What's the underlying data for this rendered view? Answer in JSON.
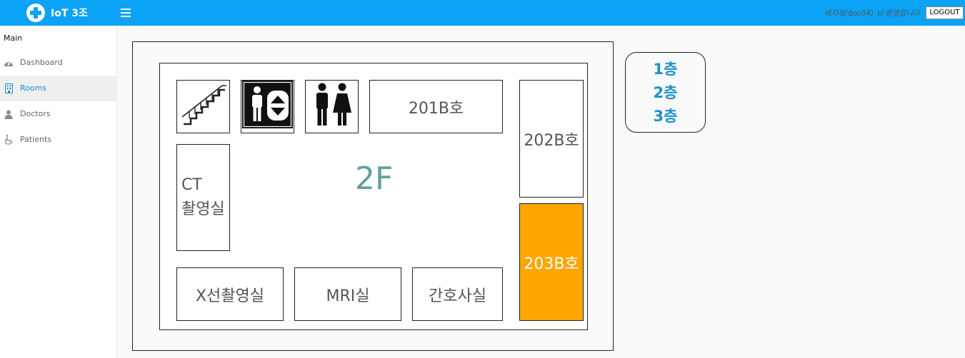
{
  "header": {
    "brand": "IoT 3조",
    "welcome": "배지희(doc04) 님 환영합니다.",
    "logout_label": "LOGOUT",
    "background_color": "#0aa3f5"
  },
  "sidebar": {
    "section": "Main",
    "items": [
      {
        "label": "Dashboard",
        "icon": "dashboard-icon",
        "active": false
      },
      {
        "label": "Rooms",
        "icon": "building-icon",
        "active": true
      },
      {
        "label": "Doctors",
        "icon": "doctor-icon",
        "active": false
      },
      {
        "label": "Patients",
        "icon": "wheelchair-icon",
        "active": false
      }
    ]
  },
  "floorplan": {
    "floor": "2F",
    "rooms": {
      "r201": "201B호",
      "r202": "202B호",
      "r203": "203B호",
      "ct_line1": "CT",
      "ct_line2": "촬영실",
      "xray": "X선촬영실",
      "mri": "MRI실",
      "nurse": "간호사실"
    },
    "facilities": [
      "stairs-icon",
      "elevator-icon",
      "restroom-icon"
    ],
    "highlight_color": "#ffa500"
  },
  "floor_menu": {
    "items": [
      "1층",
      "2층",
      "3층"
    ]
  }
}
